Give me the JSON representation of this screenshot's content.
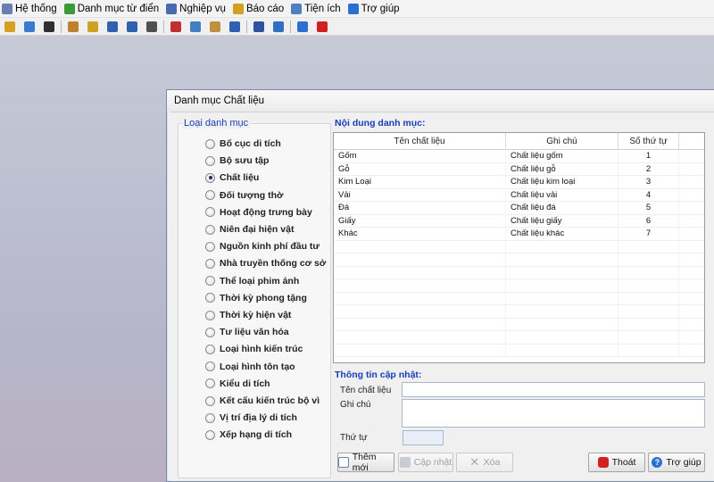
{
  "menubar": {
    "items": [
      {
        "label": "Hệ thống",
        "icon": "home-icon",
        "color": "#6a7fb0"
      },
      {
        "label": "Danh mục từ điển",
        "icon": "book-icon",
        "color": "#3a9a3a"
      },
      {
        "label": "Nghiệp vụ",
        "icon": "tools-icon",
        "color": "#4a6ab0"
      },
      {
        "label": "Báo cáo",
        "icon": "report-icon",
        "color": "#d4a020"
      },
      {
        "label": "Tiện ích",
        "icon": "user-icon",
        "color": "#5080c0"
      },
      {
        "label": "Trợ giúp",
        "icon": "help-icon",
        "color": "#2a70d0"
      }
    ]
  },
  "toolbar": {
    "icons": [
      "login-icon",
      "users-icon",
      "edit-icon",
      "key-icon",
      "settings-icon",
      "table-icon",
      "tree-icon",
      "image-icon",
      "tools-icon",
      "globe-icon",
      "archive-icon",
      "book-icon",
      "report-icon",
      "search-icon",
      "help-icon",
      "power-icon"
    ]
  },
  "dialog": {
    "title": "Danh mục Chất liệu",
    "left_group": {
      "title": "Loại danh mục",
      "selected": "Chất liệu",
      "items": [
        "Bố cục di tích",
        "Bộ sưu tập",
        "Chất liệu",
        "Đối tượng thờ",
        "Hoạt động trưng bày",
        "Niên đại hiện vật",
        "Nguồn kinh phí đầu tư",
        "Nhà truyền thống cơ sở",
        "Thể loại phim ảnh",
        "Thời kỳ phong tặng",
        "Thời kỳ hiện vật",
        "Tư liệu văn hóa",
        "Loại hình kiến trúc",
        "Loại hình tôn tạo",
        "Kiểu di tích",
        "Kết cấu kiến trúc bộ vì",
        "Vị trí địa lý di tích",
        "Xếp hạng di tích"
      ]
    },
    "content_title": "Nội dung danh mục:",
    "grid": {
      "columns": [
        "Tên chất liệu",
        "Ghi chú",
        "Số thứ tự"
      ],
      "rows": [
        {
          "name": "Gốm",
          "note": "Chất liệu gốm",
          "order": "1"
        },
        {
          "name": "Gỗ",
          "note": "Chất liệu gỗ",
          "order": "2"
        },
        {
          "name": "Kim Loại",
          "note": "Chất liệu kim loại",
          "order": "3"
        },
        {
          "name": "Vải",
          "note": "Chất liệu vải",
          "order": "4"
        },
        {
          "name": "Đá",
          "note": "Chất liệu đá",
          "order": "5"
        },
        {
          "name": "Giấy",
          "note": "Chất liệu giấy",
          "order": "6"
        },
        {
          "name": "Khác",
          "note": "Chất liệu khác",
          "order": "7"
        }
      ]
    },
    "update_title": "Thông tin cập nhật:",
    "form": {
      "name_label": "Tên chất liệu",
      "name_value": "",
      "note_label": "Ghi chú",
      "note_value": "",
      "order_label": "Thứ tự",
      "order_value": ""
    },
    "buttons": {
      "add": "Thêm mới",
      "update": "Cập nhật",
      "delete": "Xóa",
      "exit": "Thoát",
      "help": "Trợ giúp"
    },
    "colors": {
      "accent": "#1a3cb8",
      "exit_icon": "#d02020",
      "help_icon": "#2a70d0"
    }
  }
}
